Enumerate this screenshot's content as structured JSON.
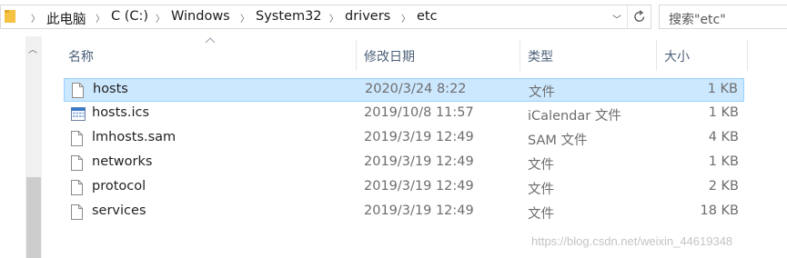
{
  "address_bar": {
    "breadcrumbs": [
      "此电脑",
      "C (C:)",
      "Windows",
      "System32",
      "drivers",
      "etc"
    ]
  },
  "search": {
    "placeholder": "搜索\"etc\""
  },
  "columns": {
    "name": "名称",
    "date": "修改日期",
    "type": "类型",
    "size": "大小"
  },
  "files": [
    {
      "name": "hosts",
      "date": "2020/3/24 8:22",
      "type": "文件",
      "size": "1 KB",
      "icon": "file-icon",
      "selected": true
    },
    {
      "name": "hosts.ics",
      "date": "2019/10/8 11:57",
      "type": "iCalendar 文件",
      "size": "1 KB",
      "icon": "calendar-icon",
      "selected": false
    },
    {
      "name": "lmhosts.sam",
      "date": "2019/3/19 12:49",
      "type": "SAM 文件",
      "size": "4 KB",
      "icon": "file-icon",
      "selected": false
    },
    {
      "name": "networks",
      "date": "2019/3/19 12:49",
      "type": "文件",
      "size": "1 KB",
      "icon": "file-icon",
      "selected": false
    },
    {
      "name": "protocol",
      "date": "2019/3/19 12:49",
      "type": "文件",
      "size": "2 KB",
      "icon": "file-icon",
      "selected": false
    },
    {
      "name": "services",
      "date": "2019/3/19 12:49",
      "type": "文件",
      "size": "18 KB",
      "icon": "file-icon",
      "selected": false
    }
  ],
  "watermark": "https://blog.csdn.net/weixin_44619348",
  "colors": {
    "selection_bg": "#cce8ff",
    "selection_border": "#99d1ff",
    "header_text": "#4c607a"
  }
}
